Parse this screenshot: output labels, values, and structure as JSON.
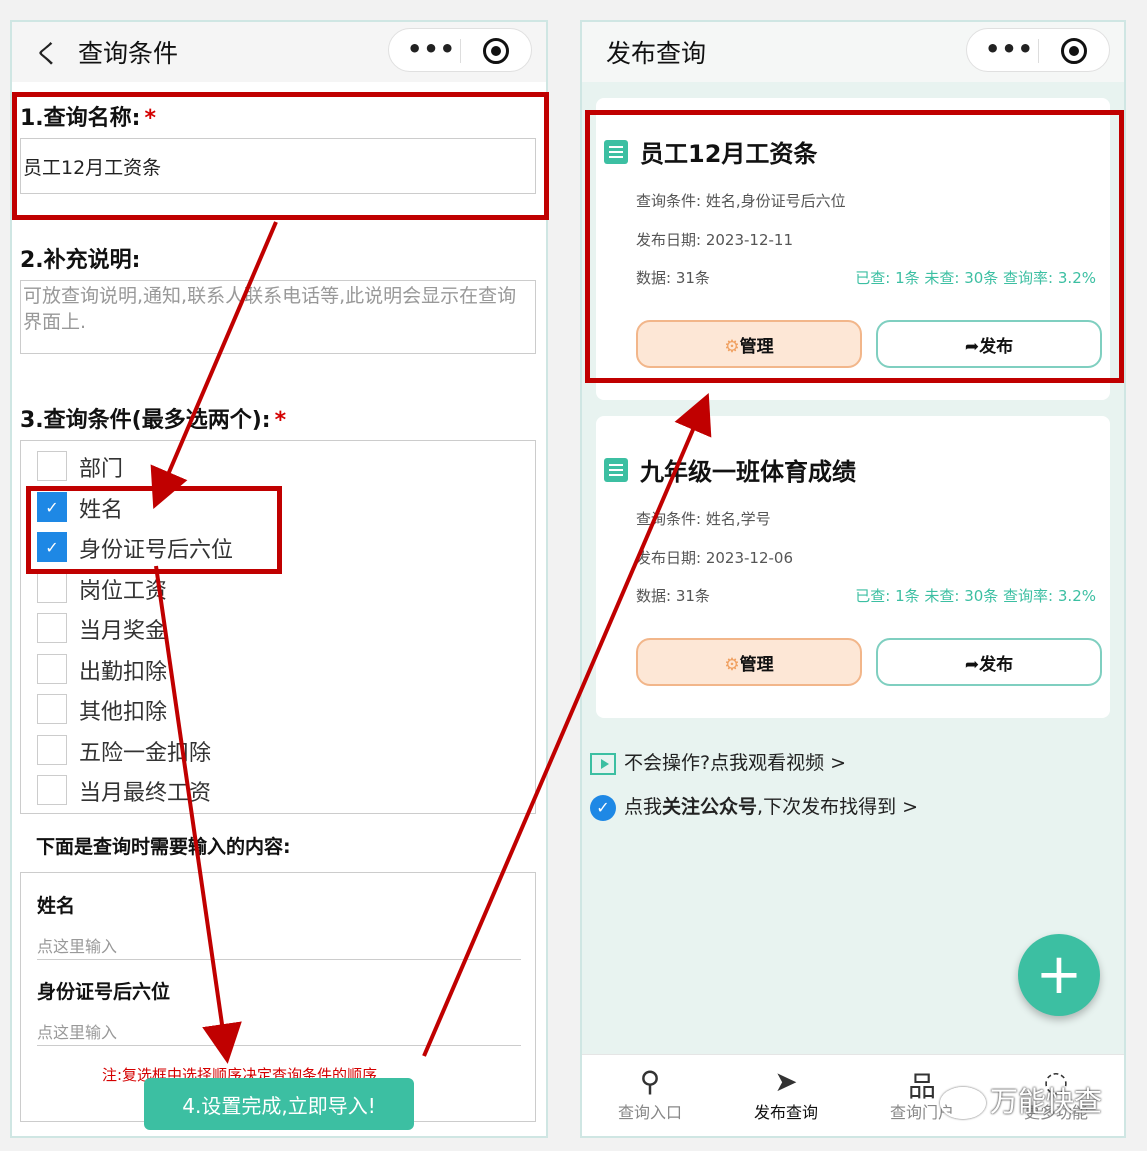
{
  "left": {
    "nav_back": "く",
    "nav_title": "查询条件",
    "capsule_dots": "•••",
    "query_name_label": "1.查询名称:",
    "required_mark": "*",
    "query_name_value": "员工12月工资条",
    "desc_label": "2.补充说明:",
    "desc_placeholder": "可放查询说明,通知,联系人联系电话等,此说明会显示在查询界面上.",
    "cond_label": "3.查询条件(最多选两个):",
    "conditions": [
      {
        "label": "部门",
        "checked": false
      },
      {
        "label": "姓名",
        "checked": true
      },
      {
        "label": "身份证号后六位",
        "checked": true
      },
      {
        "label": "岗位工资",
        "checked": false
      },
      {
        "label": "当月奖金",
        "checked": false
      },
      {
        "label": "出勤扣除",
        "checked": false
      },
      {
        "label": "其他扣除",
        "checked": false
      },
      {
        "label": "五险一金扣除",
        "checked": false
      },
      {
        "label": "当月最终工资",
        "checked": false
      }
    ],
    "check_mark": "✓",
    "input_section_title": "下面是查询时需要输入的内容:",
    "fields": [
      {
        "label": "姓名",
        "placeholder": "点这里输入"
      },
      {
        "label": "身份证号后六位",
        "placeholder": "点这里输入"
      }
    ],
    "note": "注:复选框中选择顺序决定查询条件的顺序",
    "submit_label": "4.设置完成,立即导入!"
  },
  "right": {
    "nav_title": "发布查询",
    "capsule_dots": "•••",
    "cards": [
      {
        "title": "员工12月工资条",
        "conditions": "查询条件: 姓名,身份证号后六位",
        "date": "发布日期: 2023-12-11",
        "count": "数据: 31条",
        "stats": "已查: 1条 未查: 30条 查询率: 3.2%",
        "manage_label": "管理",
        "publish_label": "发布"
      },
      {
        "title": "九年级一班体育成绩",
        "conditions": "查询条件: 姓名,学号",
        "date": "发布日期: 2023-12-06",
        "count": "数据: 31条",
        "stats": "已查: 1条 未查: 30条 查询率: 3.2%",
        "manage_label": "管理",
        "publish_label": "发布"
      }
    ],
    "help_video": "不会操作?点我观看视频 >",
    "follow_prefix": "点我",
    "follow_bold": "关注公众号",
    "follow_suffix": ",下次发布找得到 >",
    "fab_label": "+",
    "tabs": [
      {
        "icon": "search-icon",
        "label": "查询入口"
      },
      {
        "icon": "send-icon",
        "label": "发布查询"
      },
      {
        "icon": "org-icon",
        "label": "查询门户"
      },
      {
        "icon": "chat-icon",
        "label": "更多功能"
      }
    ],
    "tab_glyphs": [
      "⚲",
      "➤",
      "品",
      "◌"
    ],
    "gear_glyph": "⚙",
    "share_glyph": "➦",
    "verify_glyph": "✓"
  },
  "watermark": "万能快查",
  "colors": {
    "accent": "#3cbfa2",
    "highlight": "#c00000",
    "required": "#d40000",
    "check": "#1e88e5"
  }
}
